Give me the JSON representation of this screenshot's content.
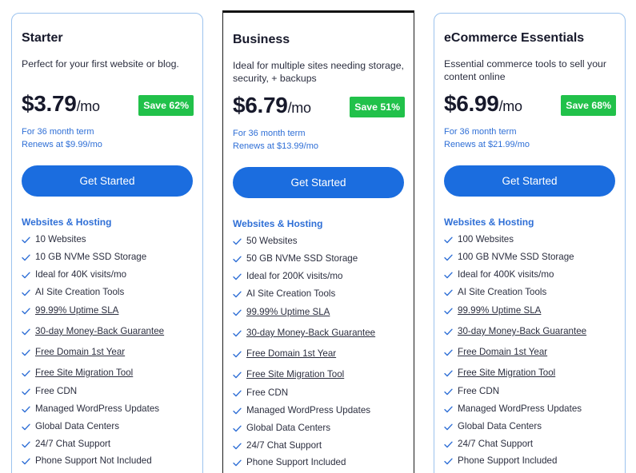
{
  "colors": {
    "accent": "#1b6ddf",
    "link_blue": "#2f6fd6",
    "save_green": "#21c14a",
    "card_border": "#9cc3ee",
    "featured_border": "#111111"
  },
  "plans": [
    {
      "name": "Starter",
      "description": "Perfect for your first website or blog.",
      "price": "$3.79",
      "period": "/mo",
      "save": "Save 62%",
      "term": "For 36 month term",
      "renew": "Renews at $9.99/mo",
      "cta": "Get Started",
      "section_title": "Websites & Hosting",
      "features": [
        {
          "text": "10 Websites",
          "icon": "check-icon"
        },
        {
          "text": "10 GB NVMe SSD Storage",
          "icon": "check-icon"
        },
        {
          "text": "Ideal for 40K visits/mo",
          "icon": "check-icon"
        },
        {
          "text": "AI Site Creation Tools",
          "icon": "check-icon"
        },
        {
          "text": "99.99% Uptime SLA",
          "icon": "check-icon"
        },
        {
          "text": "30-day Money-Back Guarantee",
          "icon": "check-icon"
        },
        {
          "text": "Free Domain 1st Year",
          "icon": "check-icon"
        },
        {
          "text": "Free Site Migration Tool",
          "icon": "check-icon"
        },
        {
          "text": "Free CDN",
          "icon": "check-icon"
        },
        {
          "text": "Managed WordPress Updates",
          "icon": "check-icon"
        },
        {
          "text": "Global Data Centers",
          "icon": "check-icon"
        },
        {
          "text": "24/7 Chat Support",
          "icon": "check-icon"
        },
        {
          "text": "Phone Support Not Included",
          "icon": "check-icon"
        }
      ]
    },
    {
      "name": "Business",
      "description": "Ideal for multiple sites needing storage, security, + backups",
      "price": "$6.79",
      "period": "/mo",
      "save": "Save 51%",
      "term": "For 36 month term",
      "renew": "Renews at $13.99/mo",
      "cta": "Get Started",
      "section_title": "Websites & Hosting",
      "features": [
        {
          "text": "50 Websites",
          "icon": "check-icon"
        },
        {
          "text": "50 GB NVMe SSD Storage",
          "icon": "check-icon"
        },
        {
          "text": "Ideal for 200K visits/mo",
          "icon": "check-icon"
        },
        {
          "text": "AI Site Creation Tools",
          "icon": "check-icon"
        },
        {
          "text": "99.99% Uptime SLA",
          "icon": "check-icon"
        },
        {
          "text": "30-day Money-Back Guarantee",
          "icon": "check-icon"
        },
        {
          "text": "Free Domain 1st Year",
          "icon": "check-icon"
        },
        {
          "text": "Free Site Migration Tool",
          "icon": "check-icon"
        },
        {
          "text": "Free CDN",
          "icon": "check-icon"
        },
        {
          "text": "Managed WordPress Updates",
          "icon": "check-icon"
        },
        {
          "text": "Global Data Centers",
          "icon": "check-icon"
        },
        {
          "text": "24/7 Chat Support",
          "icon": "check-icon"
        },
        {
          "text": "Phone Support Included",
          "icon": "check-icon"
        }
      ]
    },
    {
      "name": "eCommerce Essentials",
      "description": "Essential commerce tools to sell your content online",
      "price": "$6.99",
      "period": "/mo",
      "save": "Save 68%",
      "term": "For 36 month term",
      "renew": "Renews at $21.99/mo",
      "cta": "Get Started",
      "section_title": "Websites & Hosting",
      "features": [
        {
          "text": "100 Websites",
          "icon": "check-icon"
        },
        {
          "text": "100 GB NVMe SSD Storage",
          "icon": "check-icon"
        },
        {
          "text": "Ideal for 400K visits/mo",
          "icon": "check-icon"
        },
        {
          "text": "AI Site Creation Tools",
          "icon": "check-icon"
        },
        {
          "text": "99.99% Uptime SLA",
          "icon": "check-icon"
        },
        {
          "text": "30-day Money-Back Guarantee",
          "icon": "check-icon"
        },
        {
          "text": "Free Domain 1st Year",
          "icon": "check-icon"
        },
        {
          "text": "Free Site Migration Tool",
          "icon": "check-icon"
        },
        {
          "text": "Free CDN",
          "icon": "check-icon"
        },
        {
          "text": "Managed WordPress Updates",
          "icon": "check-icon"
        },
        {
          "text": "Global Data Centers",
          "icon": "check-icon"
        },
        {
          "text": "24/7 Chat Support",
          "icon": "check-icon"
        },
        {
          "text": "Phone Support Included",
          "icon": "check-icon"
        }
      ]
    }
  ]
}
